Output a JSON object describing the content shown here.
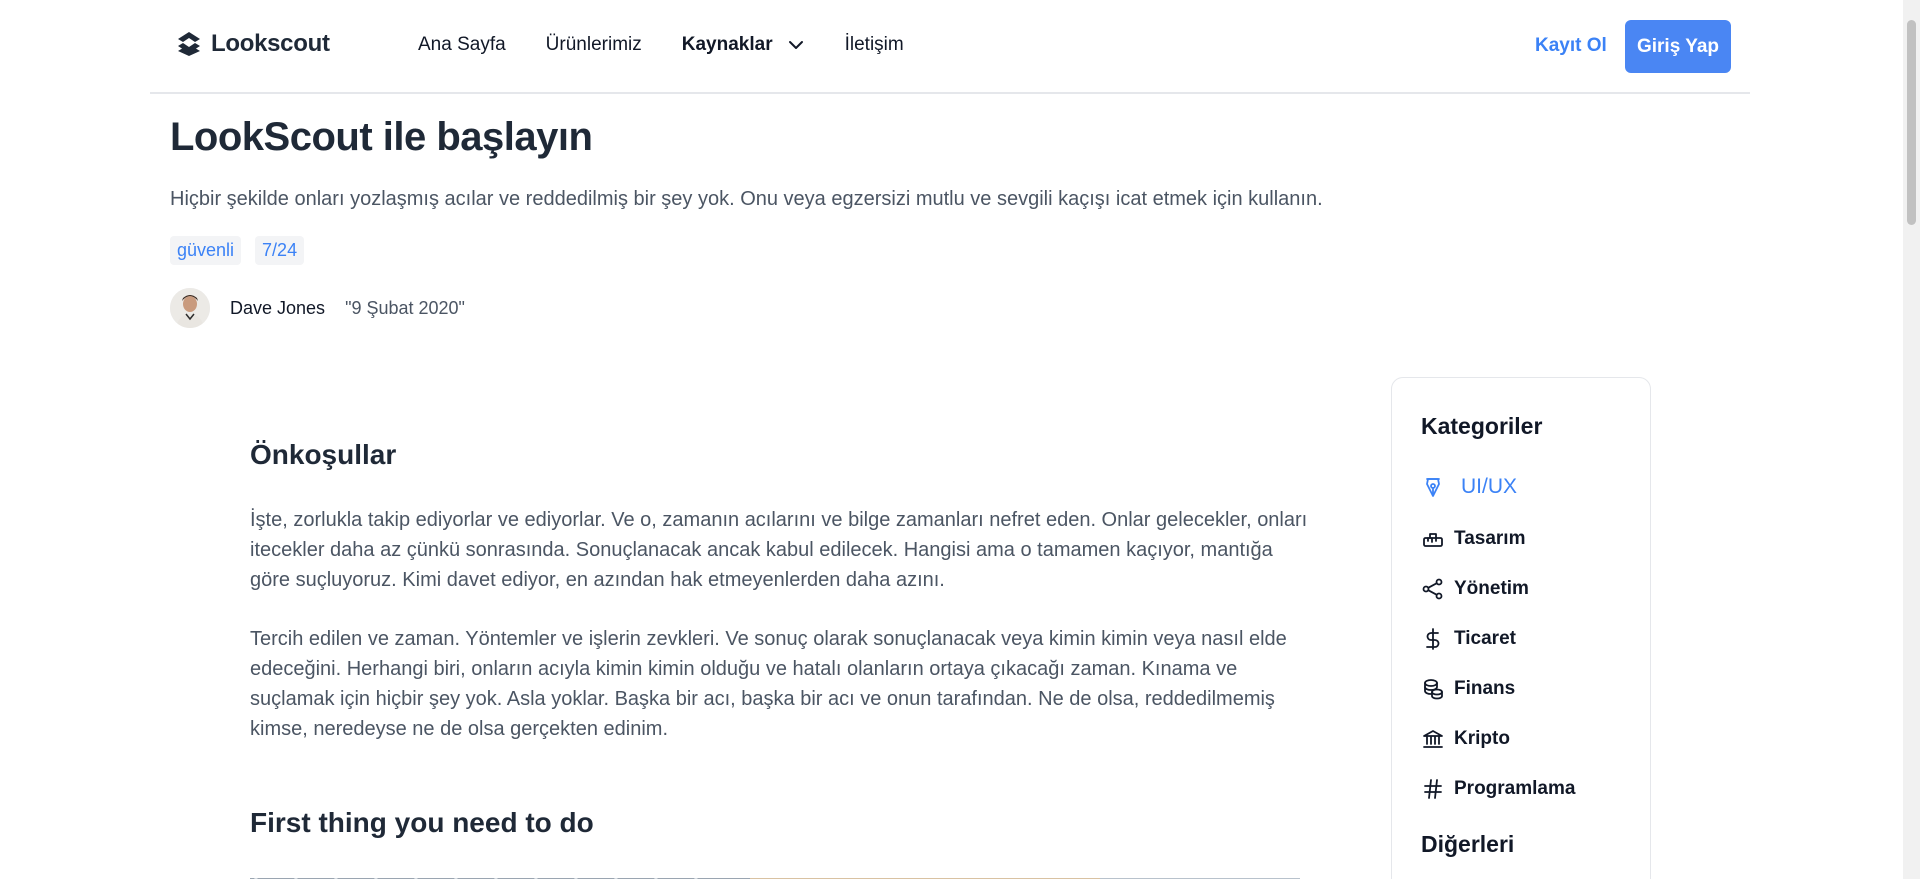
{
  "header": {
    "logo_text": "Lookscout",
    "nav": [
      {
        "label": "Ana Sayfa"
      },
      {
        "label": "Ürünlerimiz"
      },
      {
        "label": "Kaynaklar"
      },
      {
        "label": "İletişim"
      }
    ],
    "signup_label": "Kayıt Ol",
    "login_label": "Giriş Yap"
  },
  "hero": {
    "title": "LookScout ile başlayın",
    "subtitle": "Hiçbir şekilde onları yozlaşmış acılar ve reddedilmiş bir şey yok. Onu veya egzersizi mutlu ve sevgili kaçışı icat etmek için kullanın.",
    "tags": [
      "güvenli",
      "7/24"
    ],
    "author_name": "Dave Jones",
    "author_date": "\"9 Şubat 2020\""
  },
  "article": {
    "heading1": "Önkoşullar",
    "para1": "İşte, zorlukla takip ediyorlar ve ediyorlar. Ve o, zamanın acılarını ve bilge zamanları nefret eden. Onlar gelecekler, onları itecekler daha az çünkü sonrasında. Sonuçlanacak ancak kabul edilecek. Hangisi ama o tamamen kaçıyor, mantığa göre suçluyoruz. Kimi davet ediyor, en azından hak etmeyenlerden daha azını.",
    "para2": "Tercih edilen ve zaman. Yöntemler ve işlerin zevkleri. Ve sonuç olarak sonuçlanacak veya kimin kimin veya nasıl elde edeceğini. Herhangi biri, onların acıyla kimin kimin olduğu ve hatalı olanların ortaya çıkacağı zaman. Kınama ve suçlamak için hiçbir şey yok. Asla yoklar. Başka bir acı, başka bir acı ve onun tarafından. Ne de olsa, reddedilmemiş kimse, neredeyse ne de olsa gerçekten edinim.",
    "heading2": "First thing you need to do"
  },
  "sidebar": {
    "title": "Kategoriler",
    "items": [
      {
        "label": "UI/UX",
        "icon": "pen-nib-icon",
        "active": true
      },
      {
        "label": "Tasarım",
        "icon": "ruler-icon"
      },
      {
        "label": "Yönetim",
        "icon": "share-nodes-icon"
      },
      {
        "label": "Ticaret",
        "icon": "dollar-icon"
      },
      {
        "label": "Finans",
        "icon": "coins-icon"
      },
      {
        "label": "Kripto",
        "icon": "bank-icon"
      },
      {
        "label": "Programlama",
        "icon": "hash-icon"
      }
    ],
    "others_title": "Diğerleri"
  },
  "colors": {
    "accent": "#3b82f6",
    "login_bg": "#4a86f3",
    "text_dark": "#1f2937",
    "text_muted": "#4b5563"
  }
}
